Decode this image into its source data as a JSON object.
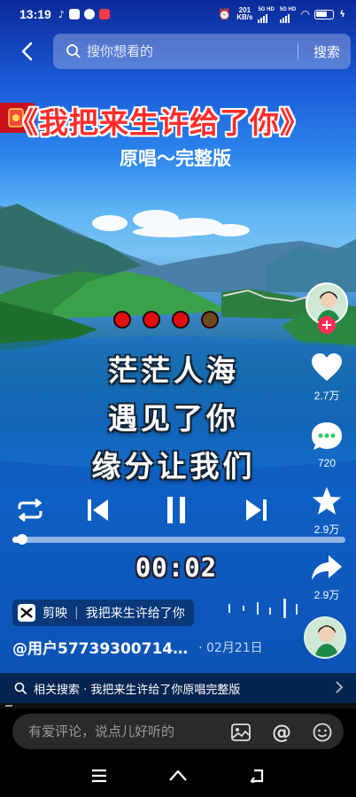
{
  "status_bar": {
    "time": "13:19",
    "net_speed_value": "201",
    "net_speed_unit": "KB/s",
    "sim1": "5G HD",
    "sim2": "5G HD"
  },
  "search": {
    "placeholder": "搜你想看的",
    "button_label": "搜索"
  },
  "video": {
    "title": "《我把来生许给了你》",
    "subtitle": "原唱～完整版",
    "lyrics": [
      "茫茫人海",
      "遇见了你",
      "缘分让我们"
    ],
    "current_time": "00:02",
    "progress": 0.03,
    "dots_active": 3,
    "dots_total": 4
  },
  "actions": {
    "likes": "2.7万",
    "comments": "720",
    "favorites": "2.9万",
    "shares": "2.9万"
  },
  "info": {
    "source_app": "剪映",
    "source_title": "我把来生许给了你",
    "author": "@用户57739300714…",
    "date": "· 02月21日"
  },
  "related": {
    "label": "相关搜索 · 我把来生许给了你原唱完整版"
  },
  "comment": {
    "placeholder": "有爱评论，说点儿好听的"
  },
  "colors": {
    "title_red": "#ff2c2c",
    "follow_pink": "#fe2c55",
    "dot_red": "#e01010"
  },
  "icons": [
    "back-arrow-icon",
    "search-icon",
    "heart-icon",
    "comment-icon",
    "star-icon",
    "share-icon",
    "repeat-icon",
    "previous-icon",
    "pause-icon",
    "next-icon",
    "image-icon",
    "at-icon",
    "emoji-icon",
    "menu-icon",
    "home-icon",
    "back-icon"
  ]
}
